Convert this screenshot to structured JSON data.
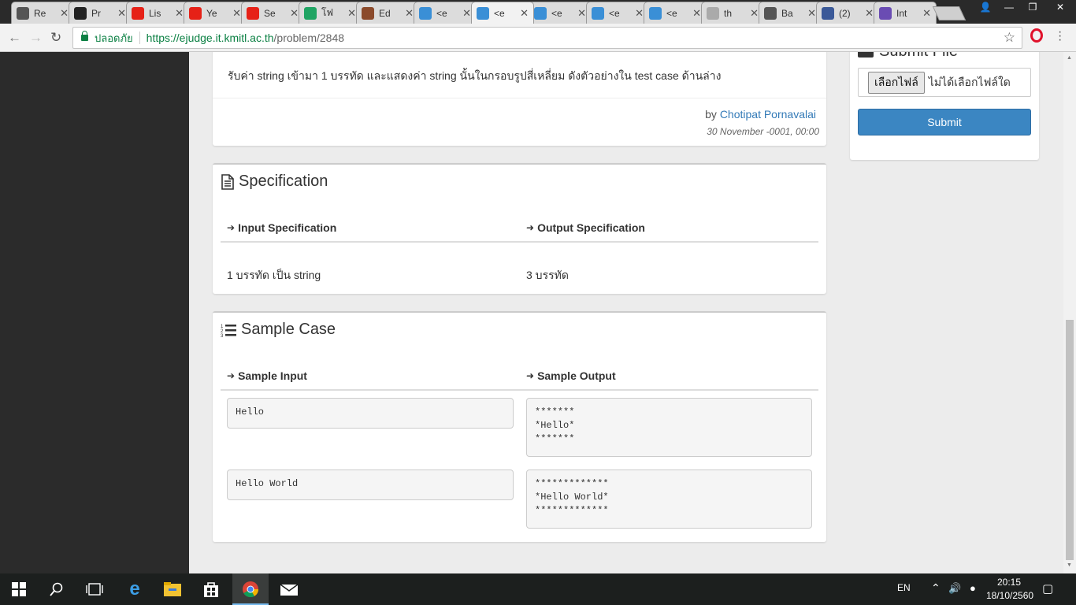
{
  "browser": {
    "tabs": [
      {
        "label": "Re",
        "icon": "document-icon",
        "color": "#555555"
      },
      {
        "label": "Pr",
        "icon": "github-icon",
        "color": "#222222"
      },
      {
        "label": "Lis",
        "icon": "youtube-icon",
        "color": "#e62117"
      },
      {
        "label": "Ye",
        "icon": "youtube-icon",
        "color": "#e62117"
      },
      {
        "label": "Se",
        "icon": "youtube-icon",
        "color": "#e62117"
      },
      {
        "label": "โฟ",
        "icon": "google-drive-icon",
        "color": "#1fa463"
      },
      {
        "label": "Ed",
        "icon": "avatar-icon",
        "color": "#8b4a2b"
      },
      {
        "label": "<e",
        "icon": "it-icon",
        "color": "#3a8fd6"
      },
      {
        "label": "<e",
        "icon": "it-icon",
        "color": "#3a8fd6"
      },
      {
        "label": "<e",
        "icon": "it-icon",
        "color": "#3a8fd6"
      },
      {
        "label": "<e",
        "icon": "it-icon",
        "color": "#3a8fd6"
      },
      {
        "label": "<e",
        "icon": "it-icon",
        "color": "#3a8fd6"
      },
      {
        "label": "th",
        "icon": "page-icon",
        "color": "#aaaaaa"
      },
      {
        "label": "Ba",
        "icon": "book-icon",
        "color": "#555555"
      },
      {
        "label": "(2)",
        "icon": "facebook-icon",
        "color": "#3b5998"
      },
      {
        "label": "Int",
        "icon": "list-icon",
        "color": "#6a4cb3"
      }
    ],
    "active_tab_index": 8,
    "secure_label": "ปลอดภัย",
    "url_host": "https://ejudge.it.kmitl.ac.th",
    "url_path": "/problem/2848"
  },
  "problem": {
    "description": "รับค่า string เข้ามา 1 บรรทัด และแสดงค่า string นั้นในกรอบรูปสี่เหลี่ยม ดังตัวอย่างใน test case ด้านล่าง",
    "by_label": "by",
    "author": "Chotipat Pornavalai",
    "date": "30 November -0001, 00:00"
  },
  "specification": {
    "title": "Specification",
    "input_header": "Input Specification",
    "output_header": "Output Specification",
    "input_text": "1 บรรทัด เป็น string",
    "output_text": "3 บรรทัด"
  },
  "sample_case": {
    "title": "Sample Case",
    "input_header": "Sample Input",
    "output_header": "Sample Output",
    "cases": [
      {
        "input": "Hello",
        "output": "*******\n*Hello*\n*******"
      },
      {
        "input": "Hello World",
        "output": "*************\n*Hello World*\n*************"
      }
    ]
  },
  "submit_panel": {
    "title": "Submit File",
    "choose_file": "เลือกไฟล์",
    "no_file": "ไม่ได้เลือกไฟล์ใด",
    "submit": "Submit"
  },
  "taskbar": {
    "language": "EN",
    "time": "20:15",
    "date": "18/10/2560"
  }
}
